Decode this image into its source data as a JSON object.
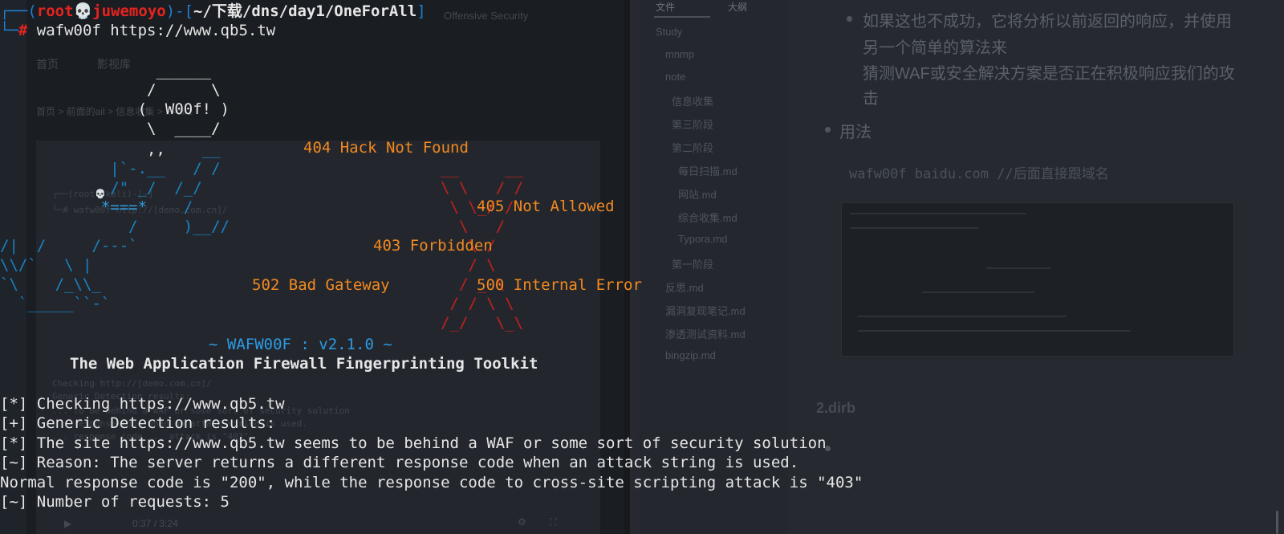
{
  "background_app": {
    "sidebar": {
      "tabs": [
        "文件",
        "大纲"
      ],
      "tree": [
        "Study",
        "mnmp",
        "note",
        "信息收集",
        "第三阶段",
        "第二阶段",
        "每日扫描.md",
        "网站.md",
        "综合收集.md",
        "Typora.md",
        "第一阶段",
        "反思.md",
        "漏洞复现笔记.md",
        "渗透测试资料.md",
        "bingzip.md"
      ]
    },
    "doc": {
      "line1": "如果这也不成功，它将分析以前返回的响应，并使用",
      "line2": "另一个简单的算法来",
      "line3": "猜测WAF或安全解决方案是否正在积极响应我们的攻",
      "line4": "击",
      "usage_label": "用法",
      "usage_code": "wafw00f baidu.com  //后面直接跟域名",
      "heading2": "2.dirb"
    },
    "video_player": {
      "title": "Offensive Security",
      "tabs": [
        "首页",
        "影视库"
      ],
      "breadcrumb": "首页 > 前面的ail > 信息收集 > ...-dir1",
      "time": "0:37 / 3:24"
    }
  },
  "terminal": {
    "prompt": {
      "corner_top": "┌──(",
      "user": "root💀juwemoyo",
      "sep": ")-[",
      "path": "~/下载/dns/day1/OneForAll",
      "close": "]",
      "corner_bottom": "└─",
      "hash": "#"
    },
    "command": " wafw00f https://www.qb5.tw",
    "ascii": {
      "frame1": "                 ______",
      "frame2": "                /      \\",
      "frame3": "               (  W00f! )",
      "frame4": "                \\  ____/",
      "frame5": "                ,,    ",
      "blue5": "__",
      "blue6": "            |`-.__   / /",
      "blue7": "            /\" _/  /_/",
      "blue8a": "           ",
      "blue8b": "*===*",
      "blue8c": "    /",
      "blue9": "              /     )__//",
      "blue10": "/|  /     /---`",
      "blue11": "\\\\/`   \\ |",
      "blue12": "`\\    /_\\\\_",
      "blue13": "  `_____``-`",
      "red1": "                                                __     __",
      "red2": "                                                \\ \\   / /",
      "red3": "                                                 \\ \\_/ /",
      "red4": "                                                  \\   /",
      "red5": "                                                   \\ /",
      "red6": "                                                   / \\",
      "red7": "                                                  / _ \\",
      "red8": "                                                 / / \\ \\",
      "red9": "                                                /_/   \\_\\"
    },
    "http_codes": {
      "c404": "404 Hack Not Found",
      "c405": "405 Not Allowed",
      "c403": "403 Forbidden",
      "c502": "502 Bad Gateway",
      "c500": "500 Internal Error"
    },
    "banner": "~ WAFW00F : v2.1.0 ~",
    "subtitle": "The Web Application Firewall Fingerprinting Toolkit",
    "output": [
      "[*] Checking https://www.qb5.tw",
      "[+] Generic Detection results:",
      "[*] The site https://www.qb5.tw seems to be behind a WAF or some sort of security solution",
      "[~] Reason: The server returns a different response code when an attack string is used.",
      "Normal response code is \"200\", while the response code to cross-site scripting attack is \"403\"",
      "[~] Number of requests: 5"
    ]
  },
  "colors": {
    "terminal_bg": "#1f232a",
    "prompt_blue": "#1e7fd1",
    "prompt_red": "#e52420",
    "ascii_blue": "#1a82c4",
    "ascii_red": "#c4211d",
    "orange": "#f3891f",
    "banner_blue": "#2b9be3"
  }
}
